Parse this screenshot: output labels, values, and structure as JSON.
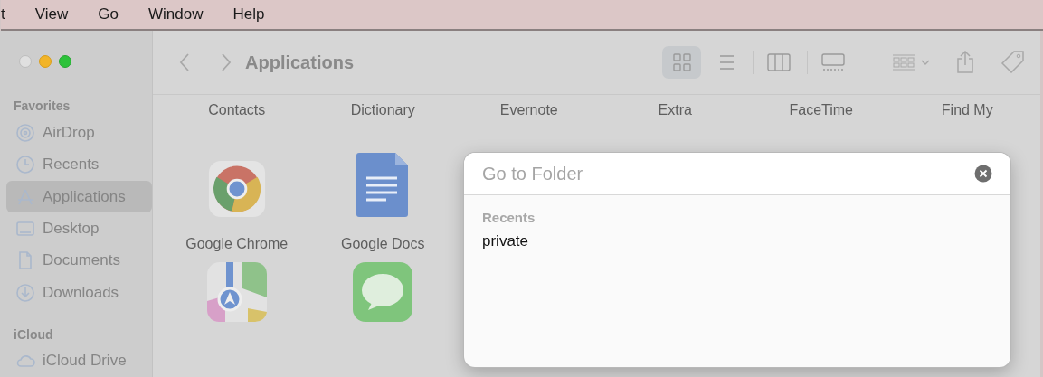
{
  "menu_bar": [
    "t",
    "View",
    "Go",
    "Window",
    "Help"
  ],
  "toolbar": {
    "title": "Applications",
    "view_modes": [
      {
        "kind": "icons",
        "selected": true
      },
      {
        "kind": "list",
        "selected": false
      },
      {
        "kind": "columns",
        "selected": false
      },
      {
        "kind": "gallery",
        "selected": false
      }
    ]
  },
  "sidebar": [
    {
      "heading": "Favorites",
      "items": [
        {
          "label": "AirDrop",
          "selected": false
        },
        {
          "label": "Recents",
          "selected": false
        },
        {
          "label": "Applications",
          "selected": true
        },
        {
          "label": "Desktop",
          "selected": false
        },
        {
          "label": "Documents",
          "selected": false
        },
        {
          "label": "Downloads",
          "selected": false
        }
      ]
    },
    {
      "heading": "iCloud",
      "items": [
        {
          "label": "iCloud Drive",
          "selected": false
        }
      ]
    }
  ],
  "top_row_labels": [
    "Contacts",
    "Dictionary",
    "Evernote",
    "Extra",
    "FaceTime",
    "Find My"
  ],
  "apps": [
    {
      "label": "Google Chrome"
    },
    {
      "label": "Google Docs"
    }
  ],
  "dialog": {
    "placeholder": "Go to Folder",
    "section_heading": "Recents",
    "recents": [
      "private"
    ]
  }
}
